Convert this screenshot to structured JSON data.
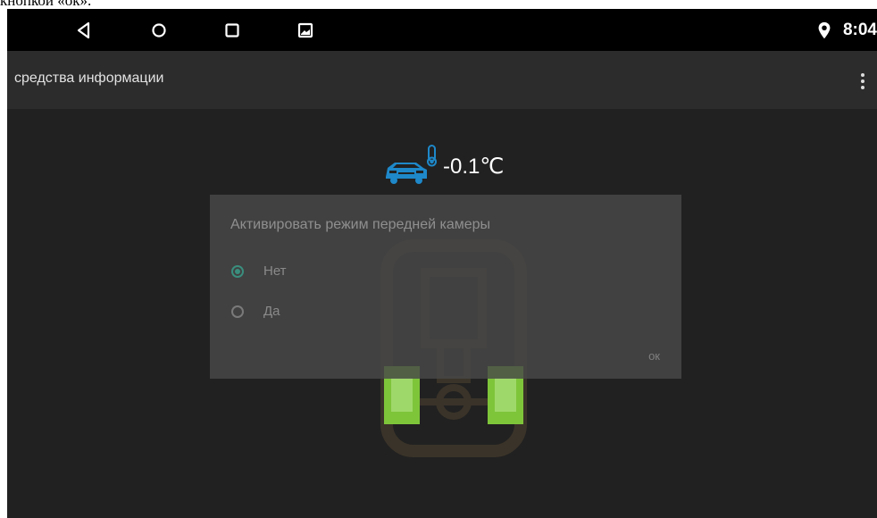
{
  "caption": "кнопкой «ок».",
  "status_bar": {
    "time": "8:04",
    "icons": [
      "back-icon",
      "home-icon",
      "recents-icon",
      "screenshot-icon",
      "location-icon"
    ]
  },
  "app_bar": {
    "title": "средства информации",
    "menu_icon": "overflow-menu-icon"
  },
  "temperature": {
    "value": "-0.1℃",
    "icon": "car-thermometer-icon",
    "icon_color": "#1e88c9"
  },
  "dialog": {
    "title": "Активировать режим передней камеры",
    "options": [
      {
        "label": "Нет",
        "selected": true
      },
      {
        "label": "Да",
        "selected": false
      }
    ],
    "ok_label": "ок"
  },
  "colors": {
    "wheel_highlight": "#7ec53a",
    "radio_accent": "#3a8e7d",
    "background": "#212121"
  }
}
